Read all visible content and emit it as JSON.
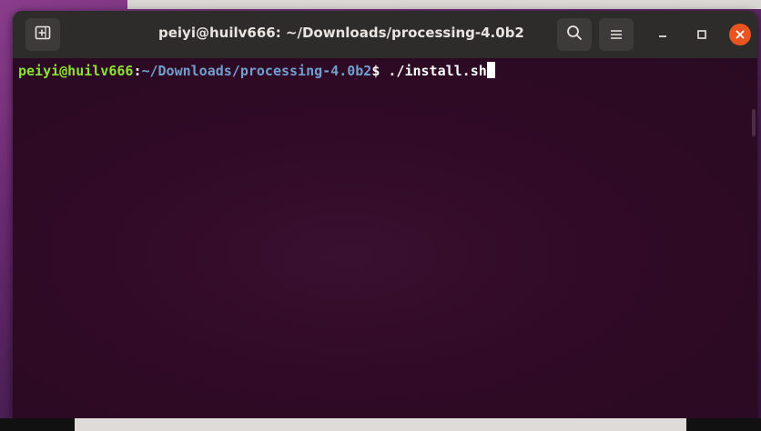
{
  "window": {
    "title": "peiyi@huilv666: ~/Downloads/processing-4.0b2"
  },
  "headerbar": {
    "new_tab_icon": "new-tab-icon",
    "search_icon": "search-icon",
    "menu_icon": "hamburger-menu-icon",
    "minimize_icon": "minimize-icon",
    "maximize_icon": "maximize-icon",
    "close_icon": "close-icon"
  },
  "terminal": {
    "prompt_user": "peiyi@huilv666",
    "prompt_separator": ":",
    "prompt_path": "~/Downloads/processing-4.0b2",
    "prompt_symbol": "$",
    "command": " ./install.sh"
  },
  "colors": {
    "headerbar": "#2d2c2b",
    "terminal_bg": "#300a26",
    "prompt_user": "#8ae234",
    "prompt_path": "#729fcf",
    "close_button": "#e95420"
  }
}
